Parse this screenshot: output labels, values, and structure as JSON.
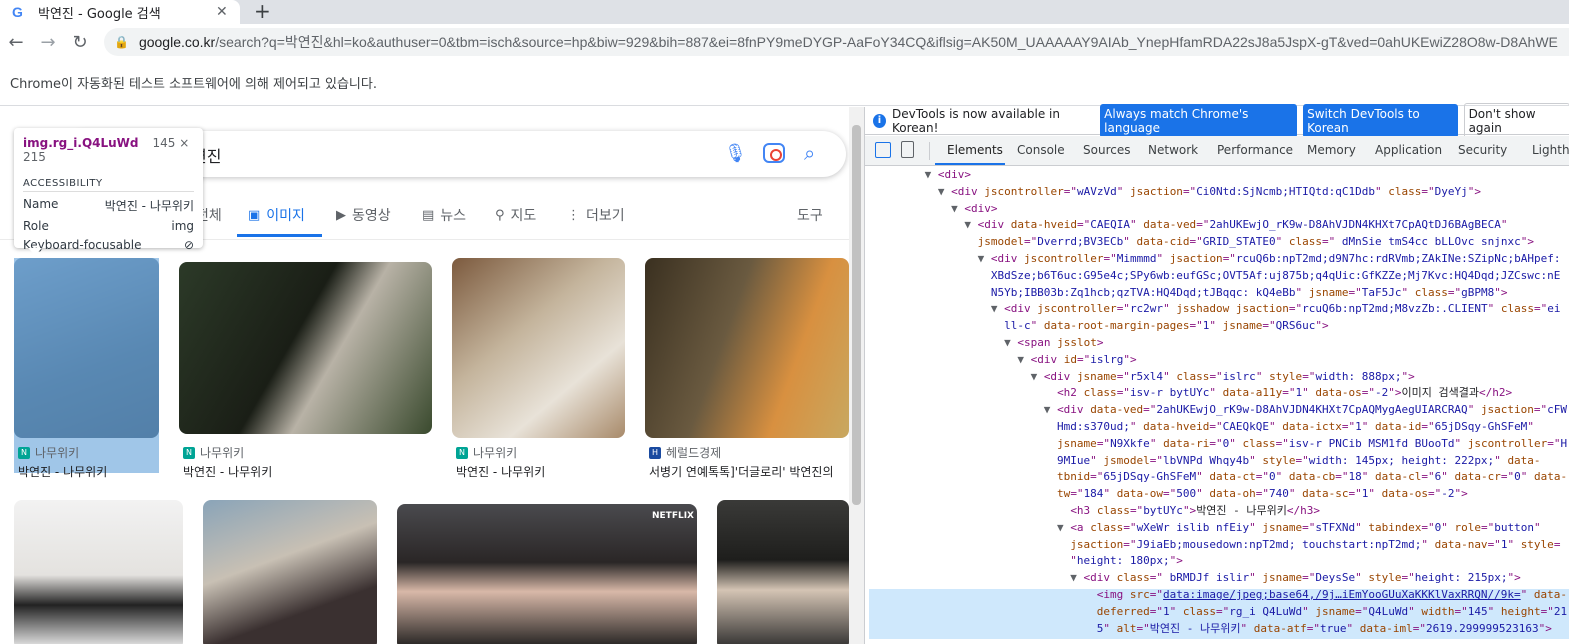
{
  "browser": {
    "tab_title": "박연진 - Google 검색",
    "url_host": "google.co.kr",
    "url_rest": "/search?q=박연진&hl=ko&authuser=0&tbm=isch&source=hp&biw=929&bih=887&ei=8fnPY9meDYGP-AaFoY34CQ&iflsig=AK50M_UAAAAAY9AIAb_YnepHfamRDA22sJ8a5JspX-gT&ved=0ahUKEwiZ28O8w-D8AhWE",
    "infobar": "Chrome이 자동화된 테스트 소프트웨어에 의해 제어되고 있습니다."
  },
  "search": {
    "query": "연진",
    "tabs": [
      {
        "label": "전체"
      },
      {
        "label": "이미지"
      },
      {
        "label": "동영상"
      },
      {
        "label": "뉴스"
      },
      {
        "label": "지도"
      },
      {
        "label": "더보기"
      }
    ],
    "tools_label": "도구"
  },
  "results": [
    {
      "source": "나무위키",
      "caption": "박연진 - 나무위키",
      "fav_color": "#00a495"
    },
    {
      "source": "나무위키",
      "caption": "박연진 - 나무위키",
      "fav_color": "#00a495"
    },
    {
      "source": "나무위키",
      "caption": "박연진 - 나무위키",
      "fav_color": "#00a495"
    },
    {
      "source": "헤럴드경제",
      "caption": "서병기 연예톡톡]'더글로리' 박연진의",
      "fav_color": "#1a4aa0"
    }
  ],
  "row2_badge": "NETFLIX",
  "tooltip": {
    "selector": "img.rg_i.Q4LuWd",
    "dims": "145 × 215",
    "section": "ACCESSIBILITY",
    "name_label": "Name",
    "name_value": "박연진 - 나무위키",
    "role_label": "Role",
    "role_value": "img",
    "focus_label": "Keyboard-focusable"
  },
  "devtools": {
    "banner_text": "DevTools is now available in Korean!",
    "btn_match": "Always match Chrome's language",
    "btn_switch": "Switch DevTools to Korean",
    "btn_dont": "Don't show again",
    "tabs": [
      "Elements",
      "Console",
      "Sources",
      "Network",
      "Performance",
      "Memory",
      "Application",
      "Security",
      "Lighthouse"
    ]
  }
}
